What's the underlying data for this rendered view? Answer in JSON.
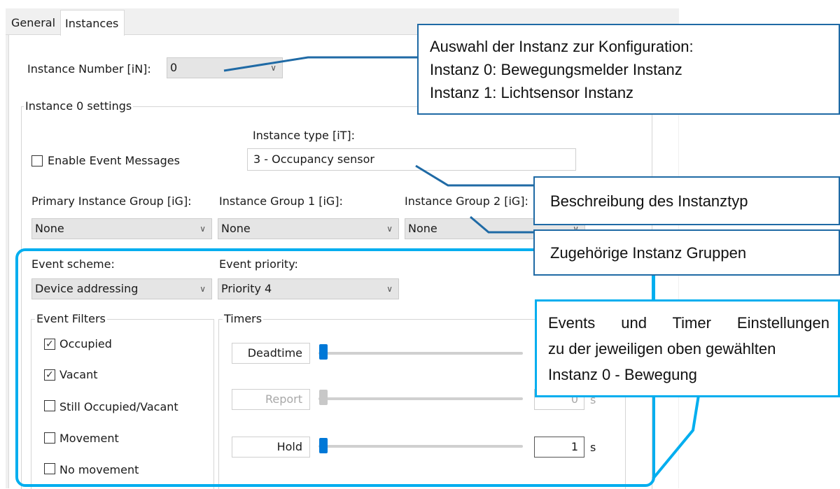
{
  "tabs": [
    {
      "label": "General"
    },
    {
      "label": "Instances"
    }
  ],
  "instance_number": {
    "label": "Instance Number [iN]:",
    "value": "0"
  },
  "settings_group": {
    "title": "Instance 0 settings"
  },
  "instance_type": {
    "label": "Instance type [iT]:",
    "value": "3 - Occupancy sensor"
  },
  "enable_events": {
    "label": "Enable Event Messages",
    "checked": false
  },
  "groups": [
    {
      "label": "Primary Instance Group [iG]:",
      "value": "None"
    },
    {
      "label": "Instance Group 1 [iG]:",
      "value": "None"
    },
    {
      "label": "Instance Group 2 [iG]:",
      "value": "None"
    }
  ],
  "event_scheme": {
    "label": "Event scheme:",
    "value": "Device addressing"
  },
  "event_priority": {
    "label": "Event priority:",
    "value": "Priority 4"
  },
  "event_filters": {
    "title": "Event Filters",
    "items": [
      {
        "label": "Occupied",
        "checked": true,
        "mark": "✓"
      },
      {
        "label": "Vacant",
        "checked": true,
        "mark": "✓"
      },
      {
        "label": "Still Occupied/Vacant",
        "checked": false,
        "mark": ""
      },
      {
        "label": "Movement",
        "checked": false,
        "mark": ""
      },
      {
        "label": "No movement",
        "checked": false,
        "mark": ""
      }
    ]
  },
  "timers": {
    "title": "Timers",
    "items": [
      {
        "label": "Deadtime",
        "enabled": true,
        "value": "",
        "unit": "",
        "level": 0
      },
      {
        "label": "Report",
        "enabled": false,
        "value": "0",
        "unit": "s",
        "level": 0
      },
      {
        "label": "Hold",
        "enabled": true,
        "value": "1",
        "unit": "s",
        "level": 0
      }
    ]
  },
  "callouts": {
    "instance_selection": [
      "Auswahl der Instanz zur Konfiguration:",
      "Instanz 0: Bewegungsmelder Instanz",
      "Instanz 1: Lichtsensor Instanz"
    ],
    "instance_type_desc": "Beschreibung des Instanztyp",
    "groups_desc": "Zugehörige Instanz Gruppen",
    "events_desc": [
      "Events und Timer Einstellungen",
      "zu der jeweiligen oben gewählten",
      "Instanz 0 - Bewegung"
    ]
  },
  "colors": {
    "callout_border": "#1f6aa5",
    "highlight_box": "#00aeef",
    "slider_thumb": "#0078d7"
  },
  "icons": {
    "dropdown": "chevron-down-icon",
    "check": "check-icon"
  }
}
